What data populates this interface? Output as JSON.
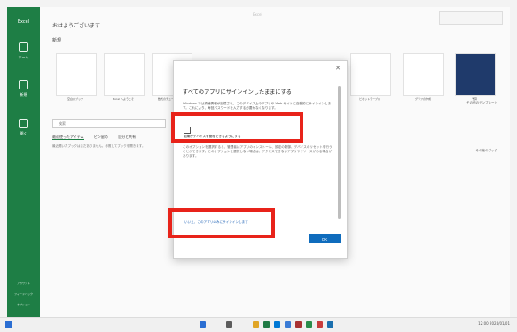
{
  "rail": {
    "app_label": "Excel",
    "nav_items": [
      {
        "label": "ホーム"
      },
      {
        "label": "新規"
      },
      {
        "label": "開く"
      }
    ],
    "bottom_items": [
      "アカウント",
      "フィードバック",
      "オプション"
    ]
  },
  "main": {
    "title": "おはようございます",
    "window_title": "Excel",
    "section_new": "新規",
    "templates": [
      {
        "label": "空白のブック"
      },
      {
        "label": "Excel へようこそ"
      },
      {
        "label": "数式のチュートリアル"
      },
      {
        "label": "ピボットテーブル"
      },
      {
        "label": "グラフの作成"
      },
      {
        "label": "予算"
      },
      {
        "label": "プロジェクト管理"
      }
    ],
    "more_templates": "その他のテンプレート",
    "search_placeholder": "検索",
    "tabs": [
      "最近使ったアイテム",
      "ピン留め",
      "自分と共有"
    ],
    "desc": "最近開いたブックはまだありません。参照してブックを開きます。",
    "more_files": "その他のブック"
  },
  "dialog": {
    "title": "すべてのアプリにサインインしたままにする",
    "body1": "Windows では資格情報が記憶され、このデバイス上のアプリや Web サイトに自動的にサインインします。これにより、毎回パスワードを入力する必要がなくなります。",
    "checkbox_label": "組織がデバイスを管理できるようにする",
    "body2": "このオプションを選択すると、管理者はアプリのインストール、設定の制御、デバイスのリセットを行うことができます。このオプションを選択しない場合は、アクセスできないアプリやリソースがある場合があります。",
    "link": "いいえ、このアプリのみにサインインします",
    "ok_label": "OK",
    "close_icon": "close-icon"
  },
  "taskbar": {
    "tray_text": "12:00 2024/01/01"
  },
  "colors": {
    "rail": "#1e7e45",
    "highlight": "#e8231a",
    "button": "#0f6cbd"
  }
}
